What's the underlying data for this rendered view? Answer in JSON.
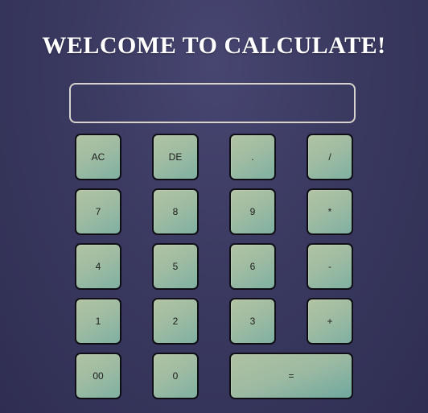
{
  "header": {
    "title": "WELCOME TO CALCULATE!"
  },
  "display": {
    "value": ""
  },
  "keypad": {
    "ac": "AC",
    "de": "DE",
    "dot": ".",
    "divide": "/",
    "seven": "7",
    "eight": "8",
    "nine": "9",
    "multiply": "*",
    "four": "4",
    "five": "5",
    "six": "6",
    "minus": "-",
    "one": "1",
    "two": "2",
    "three": "3",
    "plus": "+",
    "double_zero": "00",
    "zero": "0",
    "equals": "="
  },
  "colors": {
    "background": "#3a3960",
    "key_gradient_start": "#b2c3a2",
    "key_gradient_end": "#7fb0a2",
    "key_border": "#0e0e14",
    "display_border": "#d6d3ce",
    "title": "#ffffff"
  }
}
